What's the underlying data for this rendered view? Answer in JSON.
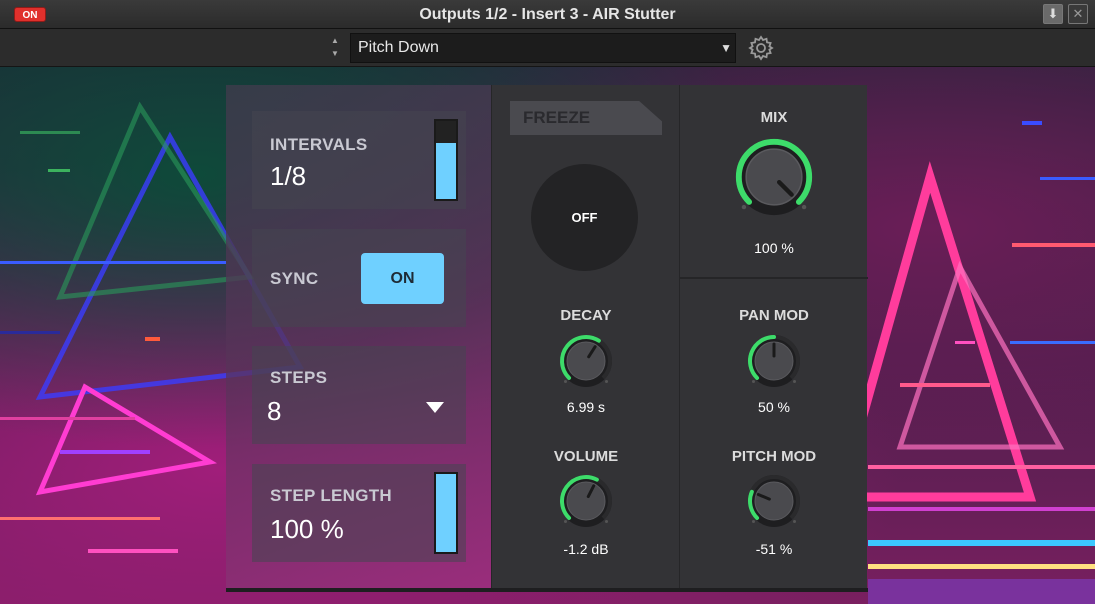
{
  "window": {
    "on_badge": "ON",
    "title": "Outputs 1/2 - Insert 3 - AIR Stutter"
  },
  "preset": {
    "name": "Pitch Down"
  },
  "icons": {
    "download": "download-icon",
    "close": "close-icon",
    "settings": "gear-icon",
    "stepper": "up-down-stepper-icon",
    "dropdown": "triangle-down-icon"
  },
  "colors": {
    "accent_blue": "#6fd0ff",
    "knob_green": "#3ddc6a",
    "on_red": "#e0302c"
  },
  "intervals": {
    "label": "INTERVALS",
    "value": "1/8",
    "level": 0.72
  },
  "sync": {
    "label": "SYNC",
    "state": "ON"
  },
  "steps": {
    "label": "STEPS",
    "value": "8"
  },
  "step_length": {
    "label": "STEP LENGTH",
    "value": "100 %",
    "level": 1.0
  },
  "freeze": {
    "label": "FREEZE",
    "state": "OFF"
  },
  "decay": {
    "label": "DECAY",
    "value": "6.99 s",
    "level": 0.62
  },
  "volume": {
    "label": "VOLUME",
    "value": "-1.2 dB",
    "level": 0.6
  },
  "mix": {
    "label": "MIX",
    "value": "100 %",
    "level": 1.0
  },
  "pan_mod": {
    "label": "PAN MOD",
    "value": "50 %",
    "level": 0.5
  },
  "pitch_mod": {
    "label": "PITCH MOD",
    "value": "-51 %",
    "level": 0.25
  }
}
